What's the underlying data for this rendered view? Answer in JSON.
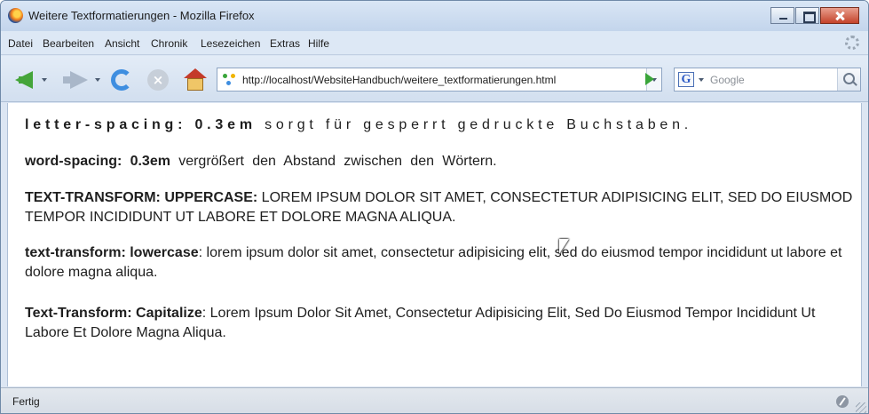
{
  "window": {
    "title": "Weitere Textformatierungen - Mozilla Firefox",
    "app_icon": "firefox-icon"
  },
  "menubar": {
    "items": [
      {
        "label": "Datei"
      },
      {
        "label": "Bearbeiten"
      },
      {
        "label": "Ansicht"
      },
      {
        "label": "Chronik"
      },
      {
        "label": "Lesezeichen"
      },
      {
        "label": "Extras"
      },
      {
        "label": "Hilfe"
      }
    ]
  },
  "navbar": {
    "url": "http://localhost/WebsiteHandbuch/weitere_textformatierungen.html",
    "search_engine_icon": "G",
    "search_placeholder": "Google",
    "icons": [
      "back-arrow-icon",
      "forward-arrow-icon",
      "reload-icon",
      "stop-icon",
      "home-icon",
      "go-arrow-icon",
      "search-icon"
    ],
    "colors": {
      "back": "#45a53a",
      "reload": "#3e8ee0",
      "home_roof": "#c43b2a"
    }
  },
  "content": {
    "p1": {
      "prop": "letter-spacing: 0.3em",
      "text": " sorgt für gesperrt gedruckte Buchstaben."
    },
    "p2": {
      "prop": "word-spacing: 0.3em",
      "text": " vergrößert den Abstand zwischen den Wörtern."
    },
    "p3": {
      "prop": "TEXT-TRANSFORM: UPPERCASE:",
      "text": " LOREM IPSUM DOLOR SIT AMET, CONSECTETUR ADIPISICING ELIT, SED DO EIUSMOD TEMPOR INCIDIDUNT UT LABORE ET DOLORE MAGNA ALIQUA."
    },
    "p4": {
      "prop": "text-transform: lowercase",
      "text": ": lorem ipsum dolor sit amet, consectetur adipisicing elit, sed do eiusmod tempor incididunt ut labore et dolore magna aliqua."
    },
    "p5": {
      "prop": "Text-transform: Capitalize",
      "text": ": Lorem Ipsum Dolor Sit Amet, Consectetur Adipisicing Elit, Sed Do Eiusmod Tempor Incididunt Ut Labore Et Dolore Magna Aliqua."
    }
  },
  "statusbar": {
    "text": "Fertig"
  }
}
